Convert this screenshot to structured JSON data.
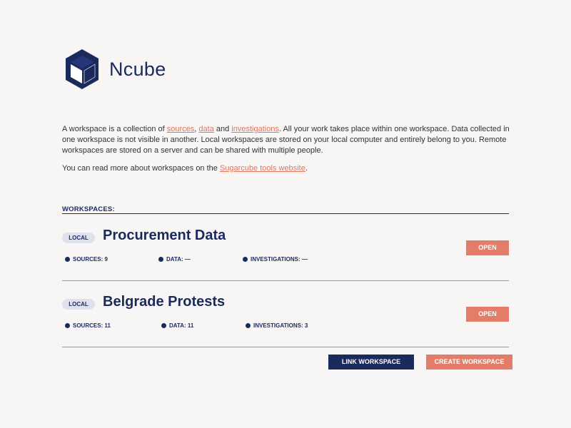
{
  "app": {
    "title": "Ncube"
  },
  "intro": {
    "p1_pre": "A workspace is a collection of ",
    "link_sources": "sources",
    "sep1": ", ",
    "link_data": "data",
    "sep2": " and ",
    "link_investigations": "investigations",
    "p1_post": ". All your work takes place within one workspace. Data collected in one workspace is not visible in another. Local workspaces are stored on your local computer and entirely belong to you. Remote workspaces are stored on a server and can be shared with multiple people.",
    "p2_pre": "You can read more about workspaces on the ",
    "link_sugarcube": "Sugarcube tools website",
    "p2_post": "."
  },
  "workspaces_label": "WORKSPACES:",
  "workspaces": [
    {
      "badge": "LOCAL",
      "title": "Procurement Data",
      "sources": "SOURCES: 9",
      "data": "DATA: —",
      "investigations": "INVESTIGATIONS: —",
      "open_label": "OPEN"
    },
    {
      "badge": "LOCAL",
      "title": "Belgrade Protests",
      "sources": "SOURCES: 11",
      "data": "DATA: 11",
      "investigations": "INVESTIGATIONS: 3",
      "open_label": "OPEN"
    }
  ],
  "actions": {
    "link_workspace": "LINK WORKSPACE",
    "create_workspace": "CREATE WORKSPACE"
  },
  "colors": {
    "navy": "#1b2a5c",
    "accent": "#e37c69",
    "link": "#e0745f",
    "background": "#f8f6f5"
  },
  "icons": {
    "logo": "ncube-cube-logo",
    "stat": "stat-bullet-icon"
  }
}
